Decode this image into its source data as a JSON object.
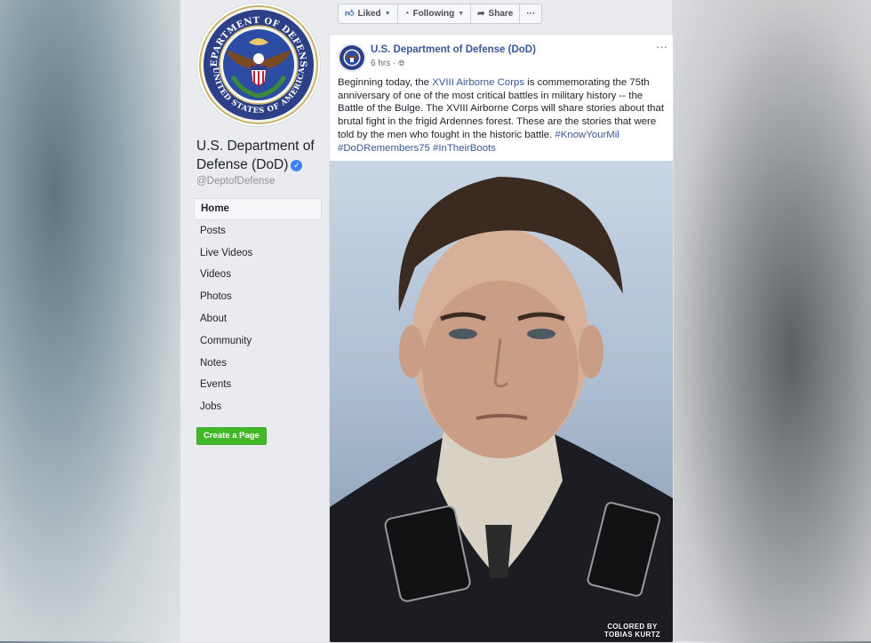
{
  "page": {
    "name": "U.S. Department of Defense (DoD)",
    "handle": "@DeptofDefense",
    "seal_text_top": "DEPARTMENT OF DEFENSE",
    "seal_text_bottom": "UNITED STATES OF AMERICA"
  },
  "nav": {
    "items": [
      "Home",
      "Posts",
      "Live Videos",
      "Videos",
      "Photos",
      "About",
      "Community",
      "Notes",
      "Events",
      "Jobs"
    ],
    "active": "Home"
  },
  "create_page": "Create a Page",
  "actions": {
    "liked": "Liked",
    "following": "Following",
    "share": "Share",
    "more": "···"
  },
  "post": {
    "author": "U.S. Department of Defense (DoD)",
    "time": "6 hrs ·",
    "menu": "···",
    "text_1": "Beginning today, the ",
    "link_corps": "XVIII Airborne Corps",
    "text_2": " is commemorating the 75th anniversary of one of the most critical battles in military history -- the Battle of the Bulge. The XVIII Airborne Corps will share stories about that brutal fight in the frigid Ardennes forest. These are the stories that were told by the men who fought in the historic battle. ",
    "hashtag_1": "#KnowYourMil",
    "hashtag_2": "#DoDRemembers75",
    "hashtag_3": "#InTheirBoots",
    "photo_credit_1": "COLORED BY",
    "photo_credit_2": "TOBIAS KURTZ"
  },
  "colors": {
    "link": "#385898",
    "green_button": "#42b72a",
    "verified": "#4080ff"
  }
}
